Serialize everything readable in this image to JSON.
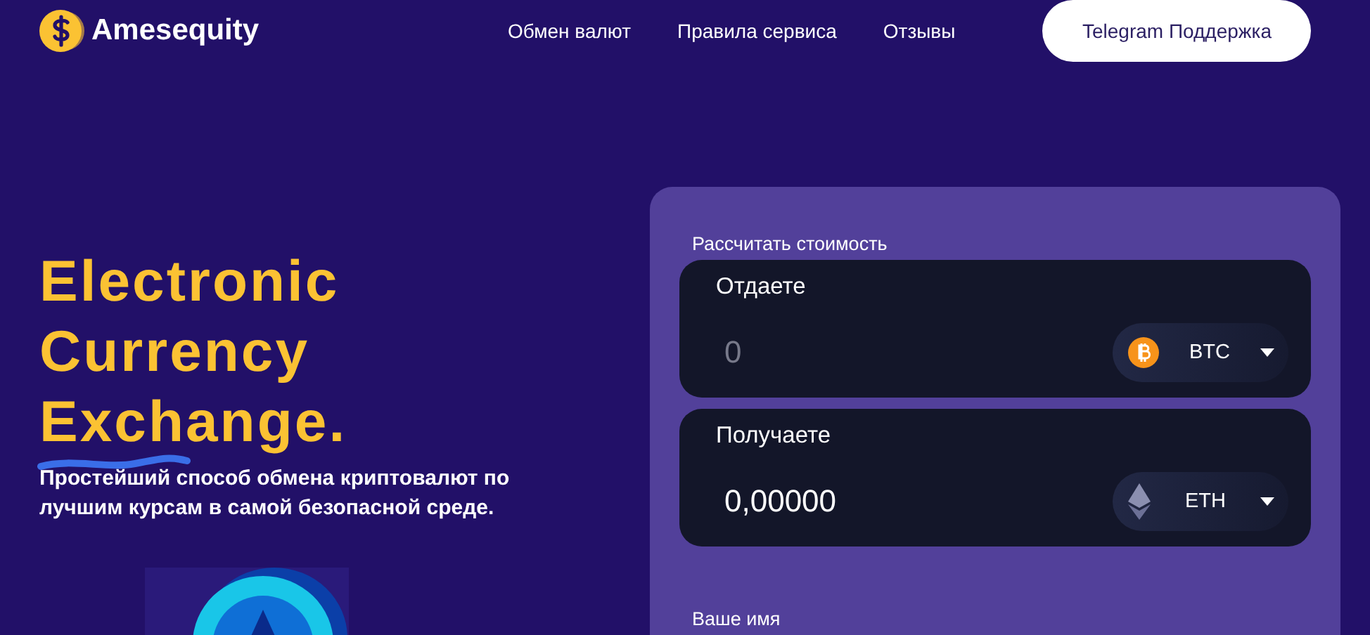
{
  "header": {
    "logo": "Amesequity",
    "nav": [
      {
        "label": "Обмен валют"
      },
      {
        "label": "Правила сервиса"
      },
      {
        "label": "Отзывы"
      }
    ],
    "support_button": "Telegram Поддержка"
  },
  "hero": {
    "title_lines": [
      "Electronic",
      "Currency",
      "Exchange."
    ],
    "subtitle": "Простейший способ обмена криптовалют по лучшим курсам в самой безопасной среде."
  },
  "exchange": {
    "title": "Рассчитать стоимость",
    "rows": [
      {
        "label": "Отдаете",
        "placeholder": "0",
        "currency": {
          "code": "BTC",
          "kind": "btc"
        }
      },
      {
        "label": "Получаете",
        "value": "0,00000",
        "currency": {
          "code": "ETH",
          "kind": "eth"
        }
      }
    ],
    "name_label": "Ваше имя"
  }
}
